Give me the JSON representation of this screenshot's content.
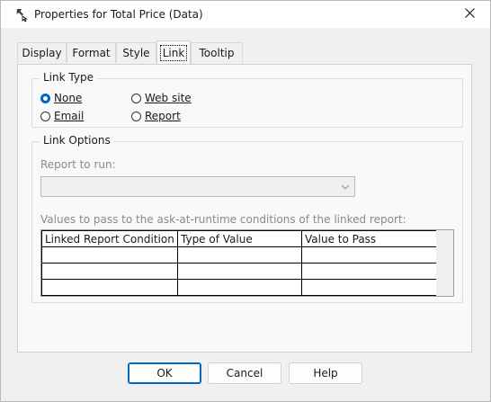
{
  "window": {
    "title": "Properties for Total Price (Data)",
    "icon": "wrench-cursor-icon"
  },
  "tabs": [
    {
      "label": "Display",
      "active": false
    },
    {
      "label": "Format",
      "active": false
    },
    {
      "label": "Style",
      "active": false
    },
    {
      "label": "Link",
      "active": true
    },
    {
      "label": "Tooltip",
      "active": false
    }
  ],
  "link_type": {
    "title": "Link Type",
    "options": [
      {
        "label": "None",
        "checked": true
      },
      {
        "label": "Web site",
        "checked": false
      },
      {
        "label": "Email",
        "checked": false
      },
      {
        "label": "Report",
        "checked": false
      }
    ]
  },
  "link_options": {
    "title": "Link Options",
    "report_label": "Report to run:",
    "report_value": "",
    "values_label": "Values to pass to the ask-at-runtime conditions of the linked report:",
    "columns": [
      "Linked Report Condition",
      "Type of Value",
      "Value to Pass"
    ],
    "rows": [
      [
        "",
        "",
        ""
      ],
      [
        "",
        "",
        ""
      ],
      [
        "",
        "",
        ""
      ]
    ]
  },
  "buttons": {
    "ok": "OK",
    "cancel": "Cancel",
    "help": "Help"
  },
  "colors": {
    "accent": "#0067c0",
    "dialog_bg": "#f0f0f0",
    "panel_bg": "#f9f9f9"
  }
}
